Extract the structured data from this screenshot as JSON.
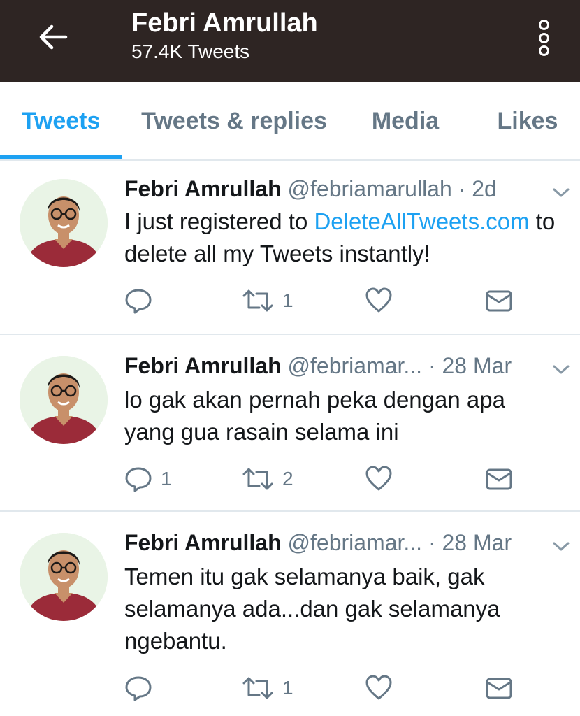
{
  "header": {
    "title": "Febri Amrullah",
    "subtitle": "57.4K Tweets"
  },
  "tabs": [
    {
      "label": "Tweets",
      "active": true
    },
    {
      "label": "Tweets & replies",
      "active": false
    },
    {
      "label": "Media",
      "active": false
    },
    {
      "label": "Likes",
      "active": false
    }
  ],
  "tweets": [
    {
      "name": "Febri Amrullah",
      "handle": "@febriamarullah",
      "time": "· 2d",
      "text_before": "I just registered to ",
      "link": "DeleteAllTweets.com",
      "text_after": " to delete all my Tweets instantly!",
      "replies": "",
      "retweets": "1"
    },
    {
      "name": "Febri Amrullah",
      "handle": "@febriamar...",
      "time": " · 28 Mar",
      "text": "lo gak akan pernah peka dengan apa yang gua rasain selama ini",
      "replies": "1",
      "retweets": "2"
    },
    {
      "name": "Febri Amrullah",
      "handle": "@febriamar...",
      "time": " · 28 Mar",
      "text": "Temen itu gak selamanya baik, gak selamanya ada...dan gak selamanya ngebantu.",
      "replies": "",
      "retweets": "1"
    }
  ],
  "colors": {
    "header_bg": "#2e2523",
    "accent": "#1da1f2",
    "secondary_text": "#657786",
    "divider": "#e1e8ed"
  },
  "icons": [
    "back-arrow-icon",
    "more-options-icon",
    "reply-icon",
    "retweet-icon",
    "like-icon",
    "message-icon",
    "chevron-down-icon"
  ]
}
